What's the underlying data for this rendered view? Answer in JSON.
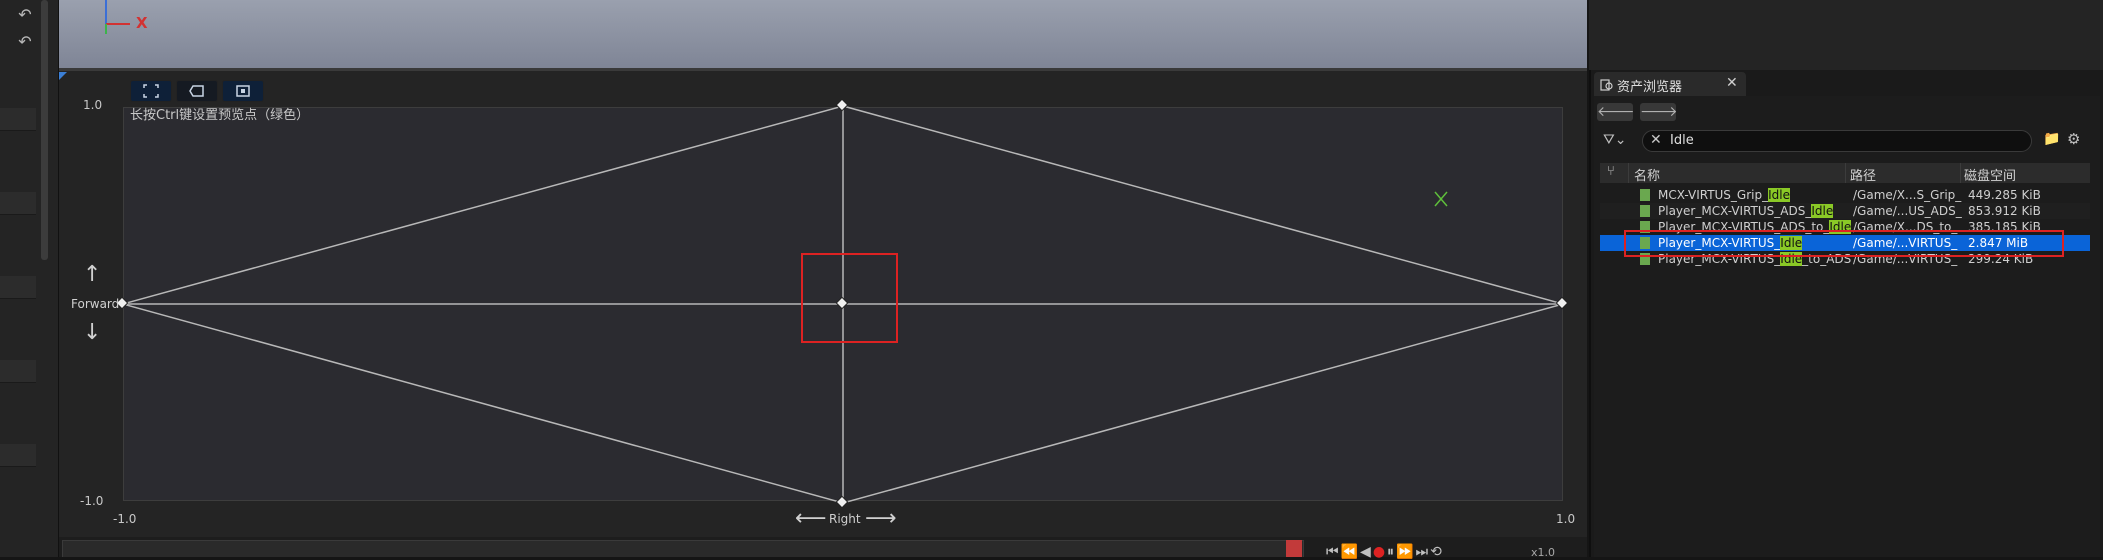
{
  "viewport": {
    "axis_x_label": "X"
  },
  "editor": {
    "hint": "长按Ctrl键设置预览点（绿色）",
    "y_max": "1.0",
    "y_min": "-1.0",
    "x_min": "-1.0",
    "x_max": "1.0",
    "vertical_axis_label": "Forward",
    "horizontal_axis_label": "Right",
    "playback_speed": "x1.0"
  },
  "asset_browser": {
    "tab_title": "资产浏览器",
    "search_value": "Idle",
    "columns": [
      "名称",
      "路径",
      "磁盘空间"
    ],
    "rows": [
      {
        "pre": "MCX-VIRTUS_Grip_",
        "hl": "Idle",
        "post": "",
        "path": "/Game/X...S_Grip_",
        "size": "449.285 KiB",
        "selected": false
      },
      {
        "pre": "Player_MCX-VIRTUS_ADS_",
        "hl": "Idle",
        "post": "",
        "path": "/Game/...US_ADS_",
        "size": "853.912 KiB",
        "selected": false
      },
      {
        "pre": "Player_MCX-VIRTUS_ADS_to_",
        "hl": "Idle",
        "post": "",
        "path": "/Game/X...DS_to_",
        "size": "385.185 KiB",
        "selected": false
      },
      {
        "pre": "Player_MCX-VIRTUS_",
        "hl": "Idle",
        "post": "",
        "path": "/Game/...VIRTUS_",
        "size": "2.847 MiB",
        "selected": true
      },
      {
        "pre": "Player_MCX-VIRTUS_",
        "hl": "Idle",
        "post": "_to_ADS",
        "path": "/Game/...VIRTUS_",
        "size": "299.24 KiB",
        "selected": false
      }
    ]
  },
  "icons": {
    "undo": "undo-icon",
    "filter": "filter-icon",
    "folder": "folder-icon",
    "settings": "gear-icon",
    "preview_marker": "preview-x-marker-icon"
  },
  "colors": {
    "selection": "#0a64d8",
    "highlight": "#8ac926",
    "annotation_red": "#dd2222"
  }
}
